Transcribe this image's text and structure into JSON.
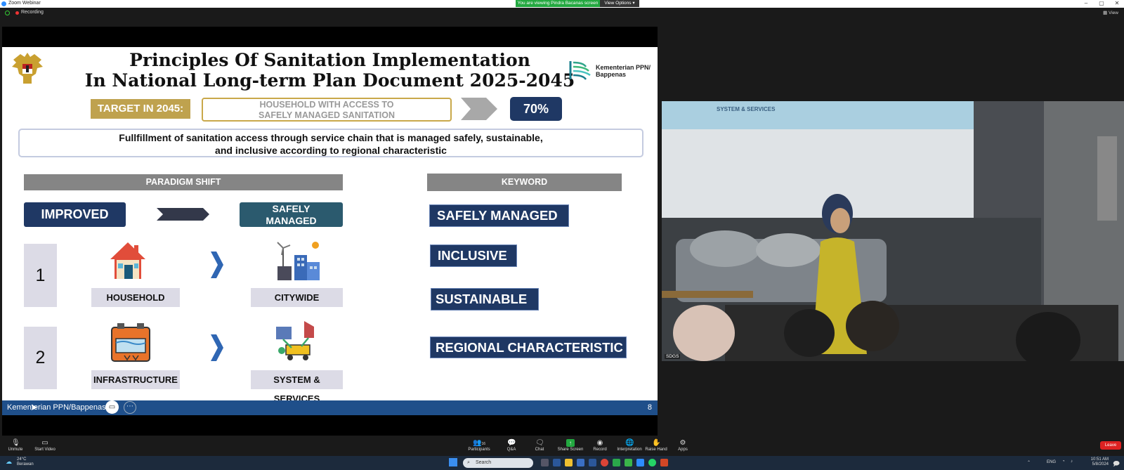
{
  "window": {
    "app_title": "Zoom Webinar",
    "viewing_banner": "You are viewing Pindra Bacanas screen",
    "view_options": "View Options",
    "recording": "Recording",
    "view_label": "View"
  },
  "slide": {
    "title_line1": "Principles Of Sanitation Implementation",
    "title_line2": "In National Long-term Plan Document 2025-2045",
    "logo_text_line1": "Kementerian PPN/",
    "logo_text_line2": "Bappenas",
    "target_label": "TARGET IN 2045:",
    "household_line1": "HOUSEHOLD WITH ACCESS TO",
    "household_line2": "SAFELY MANAGED SANITATION",
    "target_value": "70%",
    "fullfill_line1": "Fullfillment of sanitation access through service chain that is managed safely, sustainable,",
    "fullfill_line2": "and inclusive according to regional characteristic",
    "paradigm_header": "PARADIGM SHIFT",
    "keyword_header": "KEYWORD",
    "improved": "IMPROVED",
    "safely_managed_line1": "SAFELY",
    "safely_managed_line2": "MANAGED",
    "row1_num": "1",
    "row1_from": "HOUSEHOLD",
    "row1_to": "CITYWIDE",
    "row2_num": "2",
    "row2_from": "INFRASTRUCTURE",
    "row2_to": "SYSTEM & SERVICES",
    "keywords": [
      "SAFELY MANAGED",
      "INCLUSIVE",
      "SUSTAINABLE",
      "REGIONAL CHARACTERISTIC"
    ],
    "footer_org": "Kementerian PPN/Bappenas",
    "page_number": "8"
  },
  "video": {
    "participant_name": "SDGS",
    "screen_text": "SYSTEM & SERVICES"
  },
  "toolbar": {
    "unmute": "Unmute",
    "start_video": "Start Video",
    "participants": "Participants",
    "participants_count": "16",
    "qa": "Q&A",
    "chat": "Chat",
    "share_screen": "Share Screen",
    "record": "Record",
    "interpretation": "Interpretation",
    "raise_hand": "Raise Hand",
    "apps": "Apps",
    "leave": "Leave"
  },
  "taskbar": {
    "weather_line1": "24°C",
    "weather_line2": "Berawan",
    "search_placeholder": "Search",
    "lang": "ENG",
    "time": "10:51 AM",
    "date": "5/8/2024"
  },
  "colors": {
    "navy": "#1f3864",
    "gold": "#bfa24e",
    "gray_header": "#858585",
    "teal": "#2b5a6e",
    "footer_blue": "#1f4f8a",
    "banner_green": "#23a840",
    "leave_red": "#dd2222"
  }
}
